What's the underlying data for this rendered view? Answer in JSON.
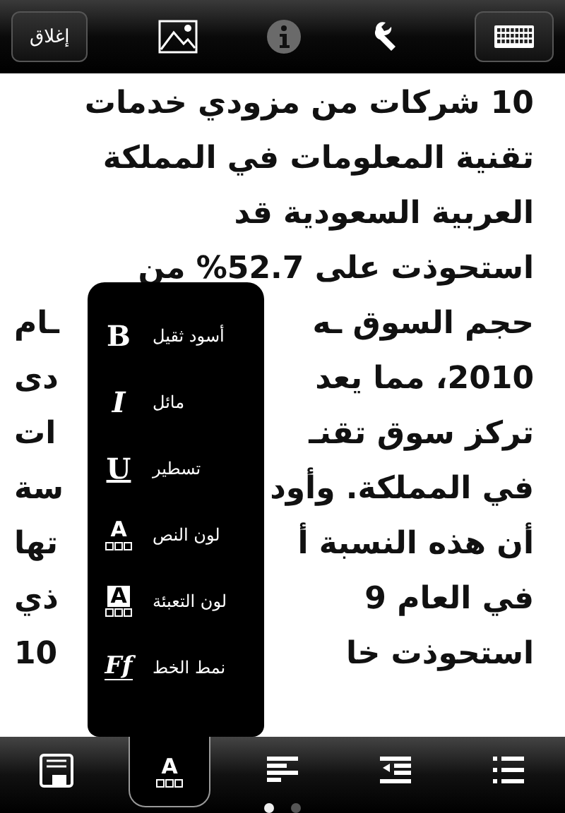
{
  "top_toolbar": {
    "close_button": "إغلاق",
    "tools": [
      {
        "kind": "image"
      },
      {
        "kind": "info"
      },
      {
        "kind": "settings"
      },
      {
        "kind": "keyboard"
      }
    ]
  },
  "body_lines": [
    {
      "segments": [
        "10 شركات من مزودي خدمات"
      ]
    },
    {
      "segments": [
        "تقنية المعلومات في المملكة"
      ]
    },
    {
      "segments": [
        "العربية السعودية قد"
      ]
    },
    {
      "segments": [
        "استحوذت على 52.7% من"
      ]
    },
    {
      "segments": [
        "حجم السوق ـه",
        "ـام"
      ]
    },
    {
      "segments": [
        "2010، مما يعد",
        "دى"
      ]
    },
    {
      "segments": [
        "تركز سوق تقنـ",
        "ات"
      ]
    },
    {
      "segments": [
        "في المملكة. وأود",
        "سة"
      ]
    },
    {
      "segments": [
        "أن هذه النسبة أ",
        "تها"
      ]
    },
    {
      "segments": [
        "في العام 9",
        "ذي"
      ]
    },
    {
      "segments": [
        "استحوذت خا",
        "10"
      ]
    }
  ],
  "format_menu": {
    "items": [
      {
        "kind": "bold",
        "glyph": "B",
        "label": "أسود ثقيل"
      },
      {
        "kind": "italic",
        "glyph": "I",
        "label": "مائل"
      },
      {
        "kind": "underline",
        "glyph": "U",
        "label": "تسطير"
      },
      {
        "kind": "text-color",
        "glyph": "A",
        "label": "لون النص"
      },
      {
        "kind": "fill-color",
        "glyph": "A",
        "label": "لون التعبئة"
      },
      {
        "kind": "font-style",
        "glyph": "Ff",
        "label": "نمط الخط"
      }
    ]
  },
  "bottom_toolbar": {
    "tabs": [
      {
        "kind": "save",
        "selected": false
      },
      {
        "kind": "text-color",
        "glyph": "A",
        "selected": true
      },
      {
        "kind": "align",
        "selected": false
      },
      {
        "kind": "indent",
        "selected": false
      },
      {
        "kind": "list",
        "selected": false
      }
    ]
  },
  "page_dots": [
    {
      "selected": true
    },
    {
      "selected": false
    }
  ]
}
